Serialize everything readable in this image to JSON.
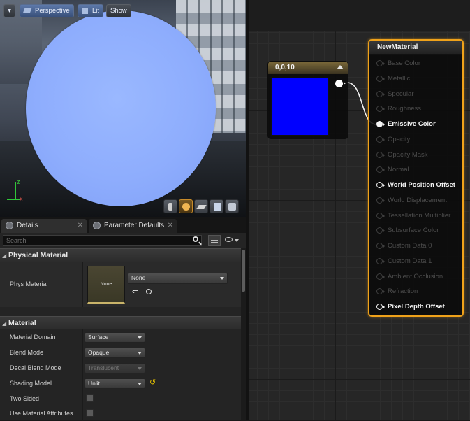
{
  "viewport": {
    "menu_caret": "▾",
    "perspective_label": "Perspective",
    "lit_label": "Lit",
    "show_label": "Show",
    "axis_x_label": "x",
    "axis_y_label": "z",
    "tools": [
      "cylinder-icon",
      "sphere-icon",
      "plane-icon",
      "cube-icon",
      "mesh-icon"
    ]
  },
  "details": {
    "tabs": [
      {
        "label": "Details"
      },
      {
        "label": "Parameter Defaults"
      }
    ],
    "search_placeholder": "Search",
    "physical_section": "Physical Material",
    "phys_material": {
      "label": "Phys Material",
      "thumb_text": "None",
      "dropdown_value": "None"
    },
    "material_section": "Material",
    "material_props": [
      {
        "label": "Material Domain",
        "value": "Surface",
        "type": "dropdown",
        "enabled": true
      },
      {
        "label": "Blend Mode",
        "value": "Opaque",
        "type": "dropdown",
        "enabled": true
      },
      {
        "label": "Decal Blend Mode",
        "value": "Translucent",
        "type": "dropdown",
        "enabled": false
      },
      {
        "label": "Shading Model",
        "value": "Unlit",
        "type": "dropdown",
        "enabled": true
      },
      {
        "label": "Two Sided",
        "type": "checkbox",
        "checked": false
      },
      {
        "label": "Use Material Attributes",
        "type": "checkbox",
        "checked": false
      }
    ]
  },
  "graph": {
    "constant_node": {
      "title": "0,0,10",
      "color": "#0000ff"
    },
    "material_node": {
      "title": "NewMaterial",
      "inputs": [
        {
          "label": "Base Color",
          "active": false,
          "connected": false
        },
        {
          "label": "Metallic",
          "active": false,
          "connected": false
        },
        {
          "label": "Specular",
          "active": false,
          "connected": false
        },
        {
          "label": "Roughness",
          "active": false,
          "connected": false
        },
        {
          "label": "Emissive Color",
          "active": true,
          "connected": true
        },
        {
          "label": "Opacity",
          "active": false,
          "connected": false
        },
        {
          "label": "Opacity Mask",
          "active": false,
          "connected": false
        },
        {
          "label": "Normal",
          "active": false,
          "connected": false
        },
        {
          "label": "World Position Offset",
          "active": true,
          "connected": false
        },
        {
          "label": "World Displacement",
          "active": false,
          "connected": false
        },
        {
          "label": "Tessellation Multiplier",
          "active": false,
          "connected": false
        },
        {
          "label": "Subsurface Color",
          "active": false,
          "connected": false
        },
        {
          "label": "Custom Data 0",
          "active": false,
          "connected": false
        },
        {
          "label": "Custom Data 1",
          "active": false,
          "connected": false
        },
        {
          "label": "Ambient Occlusion",
          "active": false,
          "connected": false
        },
        {
          "label": "Refraction",
          "active": false,
          "connected": false
        },
        {
          "label": "Pixel Depth Offset",
          "active": true,
          "connected": false
        }
      ]
    },
    "accent_color": "#f0a21a"
  }
}
